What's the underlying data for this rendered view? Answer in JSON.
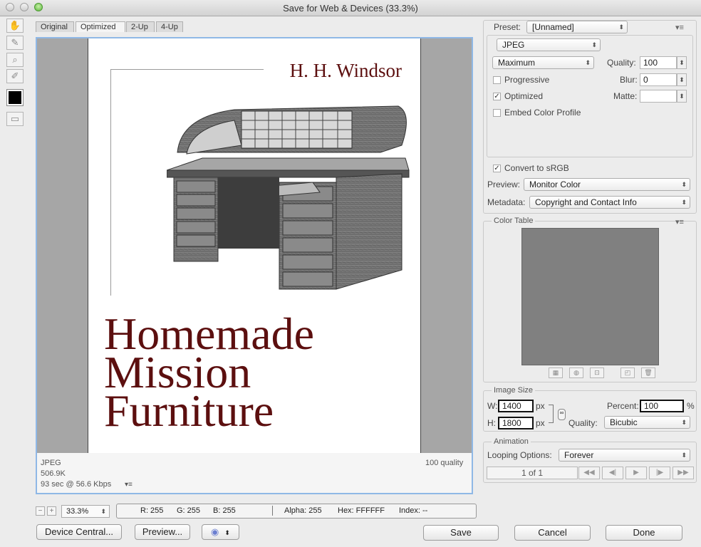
{
  "window": {
    "title": "Save for Web & Devices (33.3%)"
  },
  "tabs": [
    "Original",
    "Optimized",
    "2-Up",
    "4-Up"
  ],
  "document": {
    "author": "H. H. Windsor",
    "title_lines": [
      "Homemade",
      "Mission",
      "Furniture"
    ]
  },
  "status": {
    "format": "JPEG",
    "size": "506.9K",
    "time": "93 sec @ 56.6 Kbps",
    "quality": "100 quality"
  },
  "zoom": {
    "value": "33.3%"
  },
  "pixel_info": {
    "r": "R: 255",
    "g": "G: 255",
    "b": "B: 255",
    "alpha": "Alpha: 255",
    "hex": "Hex: FFFFFF",
    "index": "Index: --"
  },
  "buttons": {
    "device_central": "Device Central...",
    "preview": "Preview...",
    "save": "Save",
    "cancel": "Cancel",
    "done": "Done"
  },
  "settings": {
    "preset_label": "Preset:",
    "preset_value": "[Unnamed]",
    "format": "JPEG",
    "quality_level": "Maximum",
    "quality_label": "Quality:",
    "quality_value": "100",
    "blur_label": "Blur:",
    "blur_value": "0",
    "matte_label": "Matte:",
    "progressive": "Progressive",
    "optimized": "Optimized",
    "embed_color_profile": "Embed Color Profile",
    "convert_srgb": "Convert to sRGB",
    "preview_label": "Preview:",
    "preview_value": "Monitor Color",
    "metadata_label": "Metadata:",
    "metadata_value": "Copyright and Contact Info"
  },
  "color_table": {
    "title": "Color Table"
  },
  "image_size": {
    "title": "Image Size",
    "w_label": "W:",
    "w_value": "1400",
    "h_label": "H:",
    "h_value": "1800",
    "unit": "px",
    "percent_label": "Percent:",
    "percent_value": "100",
    "percent_unit": "%",
    "quality_label": "Quality:",
    "quality_value": "Bicubic"
  },
  "animation": {
    "title": "Animation",
    "looping_label": "Looping Options:",
    "looping_value": "Forever",
    "frame": "1 of 1"
  },
  "colors": {
    "title_red": "#5c0f0f",
    "focus_blue": "#8fb8e6"
  }
}
